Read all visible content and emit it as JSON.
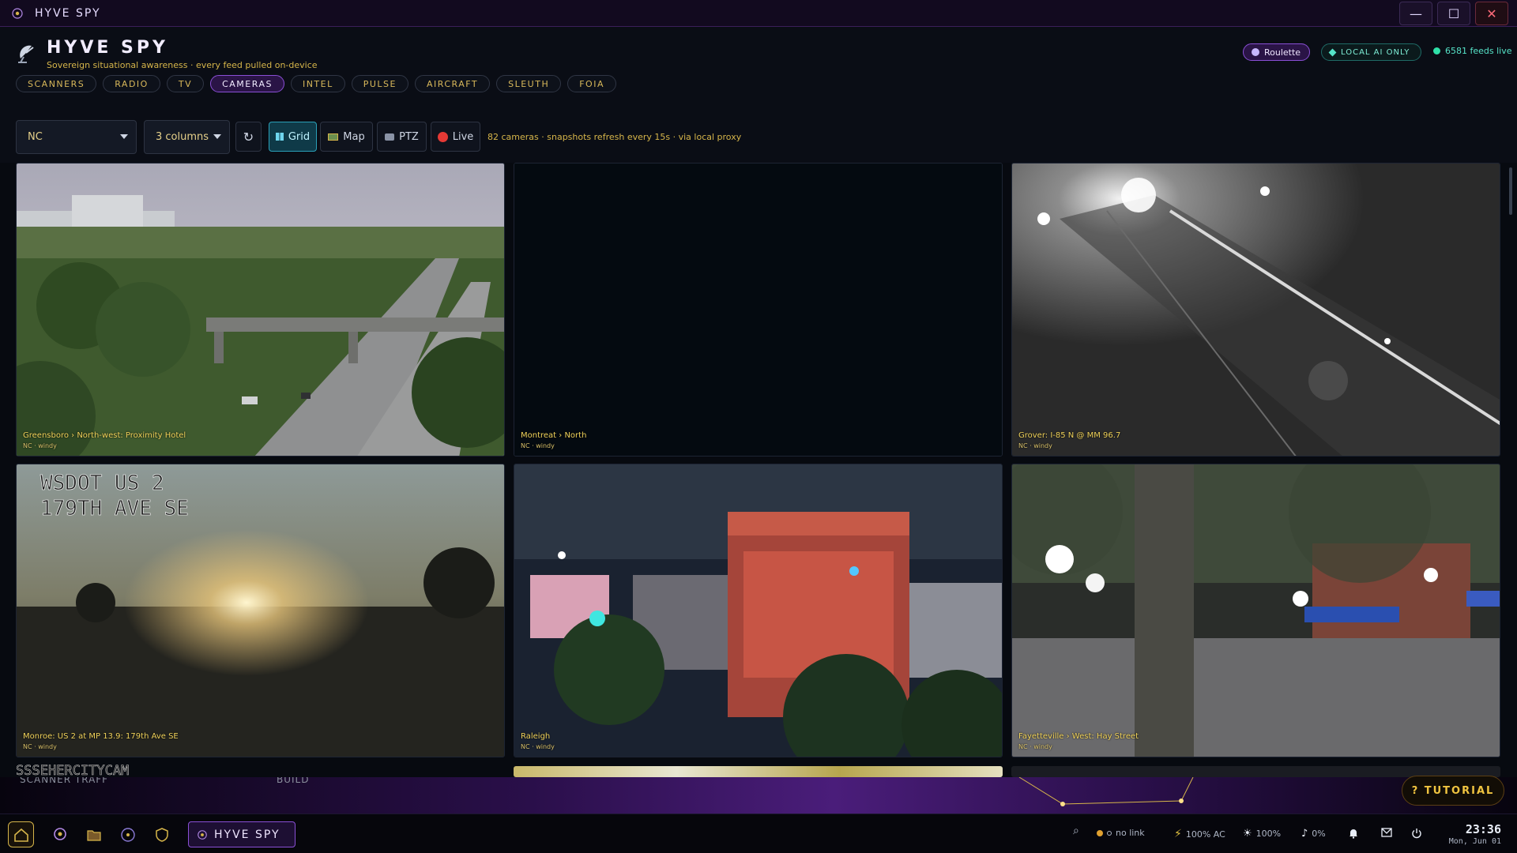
{
  "window": {
    "title": "HYVE SPY",
    "minimize": "—",
    "maximize": "☐",
    "close": "✕"
  },
  "header": {
    "title": "HYVE SPY",
    "subtitle": "Sovereign situational awareness · every feed pulled on-device",
    "roulette": "Roulette",
    "local_ai": "LOCAL AI ONLY",
    "feeds_live": "6581 feeds live"
  },
  "nav": {
    "tabs": [
      {
        "label": "SCANNERS"
      },
      {
        "label": "RADIO"
      },
      {
        "label": "TV"
      },
      {
        "label": "CAMERAS",
        "active": true
      },
      {
        "label": "INTEL"
      },
      {
        "label": "PULSE"
      },
      {
        "label": "AIRCRAFT"
      },
      {
        "label": "SLEUTH"
      },
      {
        "label": "FOIA"
      }
    ]
  },
  "toolbar": {
    "region": "NC",
    "columns": "3 columns",
    "refresh_icon": "↻",
    "grid": "Grid",
    "map": "Map",
    "ptz": "PTZ",
    "live": "Live",
    "info": "82 cameras · snapshots refresh every 15s · via local proxy"
  },
  "cameras": [
    {
      "caption": "Greensboro › North-west: Proximity Hotel",
      "meta": "NC · windy"
    },
    {
      "caption": "Montreat › North",
      "meta": "NC · windy"
    },
    {
      "caption": "Grover: I-85 N @ MM 96.7",
      "meta": "NC · windy"
    },
    {
      "caption": "Monroe: US 2 at MP 13.9: 179th Ave SE",
      "meta": "NC · windy",
      "overlay_line1": "WSDOT  US 2",
      "overlay_line2": "179TH AVE SE"
    },
    {
      "caption": "Raleigh",
      "meta": "NC · windy"
    },
    {
      "caption": "Fayetteville › West: Hay Street",
      "meta": "NC · windy"
    }
  ],
  "partial_row": {
    "text1": "SSSEHERCITYCAM",
    "text2": "SCANNER   TRAFF",
    "text3": "BUILD"
  },
  "tutorial": "? TUTORIAL",
  "taskbar": {
    "app_label": "HYVE SPY",
    "search_icon": "⌕",
    "no_link": "no link",
    "power": "100% AC",
    "brightness": "100%",
    "volume": "0%",
    "time": "23:36",
    "date": "Mon, Jun 01"
  },
  "colors": {
    "accent": "#8a4fd6",
    "gold": "#d6b54a",
    "teal": "#2aa0b8",
    "live_red": "#e53935",
    "bg": "#070a10"
  }
}
